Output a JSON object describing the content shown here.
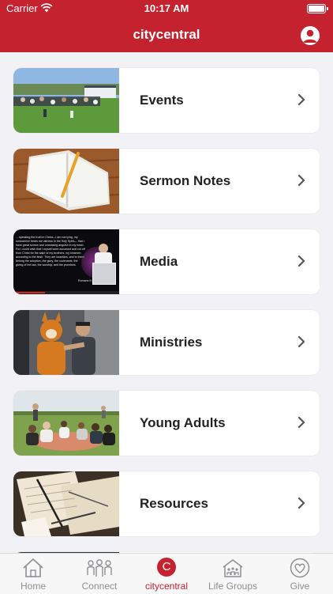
{
  "status_bar": {
    "carrier": "Carrier",
    "time": "10:17 AM"
  },
  "nav": {
    "title": "citycentral"
  },
  "menu": {
    "items": [
      {
        "label": "Events"
      },
      {
        "label": "Sermon Notes"
      },
      {
        "label": "Media"
      },
      {
        "label": "Ministries"
      },
      {
        "label": "Young Adults"
      },
      {
        "label": "Resources"
      }
    ]
  },
  "media_slide": {
    "text": "... speaking the truth in Christ—I am not lying, my conscience bears me witness in the Holy Spirit— that I have great sorrow and unceasing anguish in my heart. For I could wish that I myself were accursed and cut off from Christ for the sake of my brothers, my kinsmen according to the flesh. They are Israelites, and to them belong the adoption, the glory, the covenants, the giving of the law, the worship, and the promises.",
    "reference": "Romans 9:1-4 (ESV)"
  },
  "tab_bar": {
    "tabs": [
      {
        "label": "Home",
        "icon": "home-icon"
      },
      {
        "label": "Connect",
        "icon": "people-icon"
      },
      {
        "label": "citycentral",
        "icon": "citycentral-logo-icon",
        "glyph": "C"
      },
      {
        "label": "Life Groups",
        "icon": "house-group-icon"
      },
      {
        "label": "Give",
        "icon": "heart-icon"
      }
    ],
    "active_index": 2
  },
  "colors": {
    "brand_red": "#c4222f",
    "tab_inactive": "#8e8e93",
    "background": "#f2f2f6"
  }
}
